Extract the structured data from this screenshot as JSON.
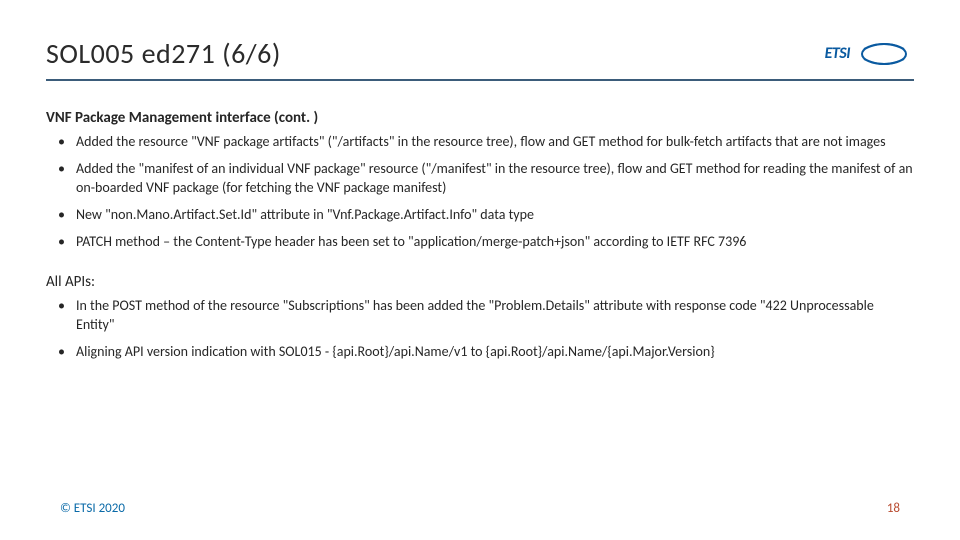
{
  "header": {
    "title": "SOL005 ed271 (6/6)",
    "logo_text": "ETSI"
  },
  "section1": {
    "heading": "VNF Package Management interface (cont. )",
    "items": [
      "Added the resource \"VNF package artifacts\" (\"/artifacts\" in the resource tree), flow and GET method for bulk-fetch artifacts that are not images",
      "Added the \"manifest of an individual VNF package\" resource (\"/manifest\" in the resource tree), flow and GET method for reading the manifest of an on-boarded VNF package (for fetching the VNF package manifest)",
      "New \"non.Mano.Artifact.Set.Id\" attribute in \"Vnf.Package.Artifact.Info\" data type",
      "PATCH method – the Content-Type header has been set to \"application/merge-patch+json\" according to IETF RFC 7396"
    ]
  },
  "section2": {
    "heading": "All APIs:",
    "items": [
      "In the POST method of the resource \"Subscriptions\" has been added the \"Problem.Details\" attribute with response code \"422 Unprocessable Entity\"",
      "Aligning API version indication with SOL015 - {api.Root}/api.Name/v1 to {api.Root}/api.Name/{api.Major.Version}"
    ]
  },
  "footer": {
    "copyright": "© ETSI 2020",
    "page": "18"
  }
}
